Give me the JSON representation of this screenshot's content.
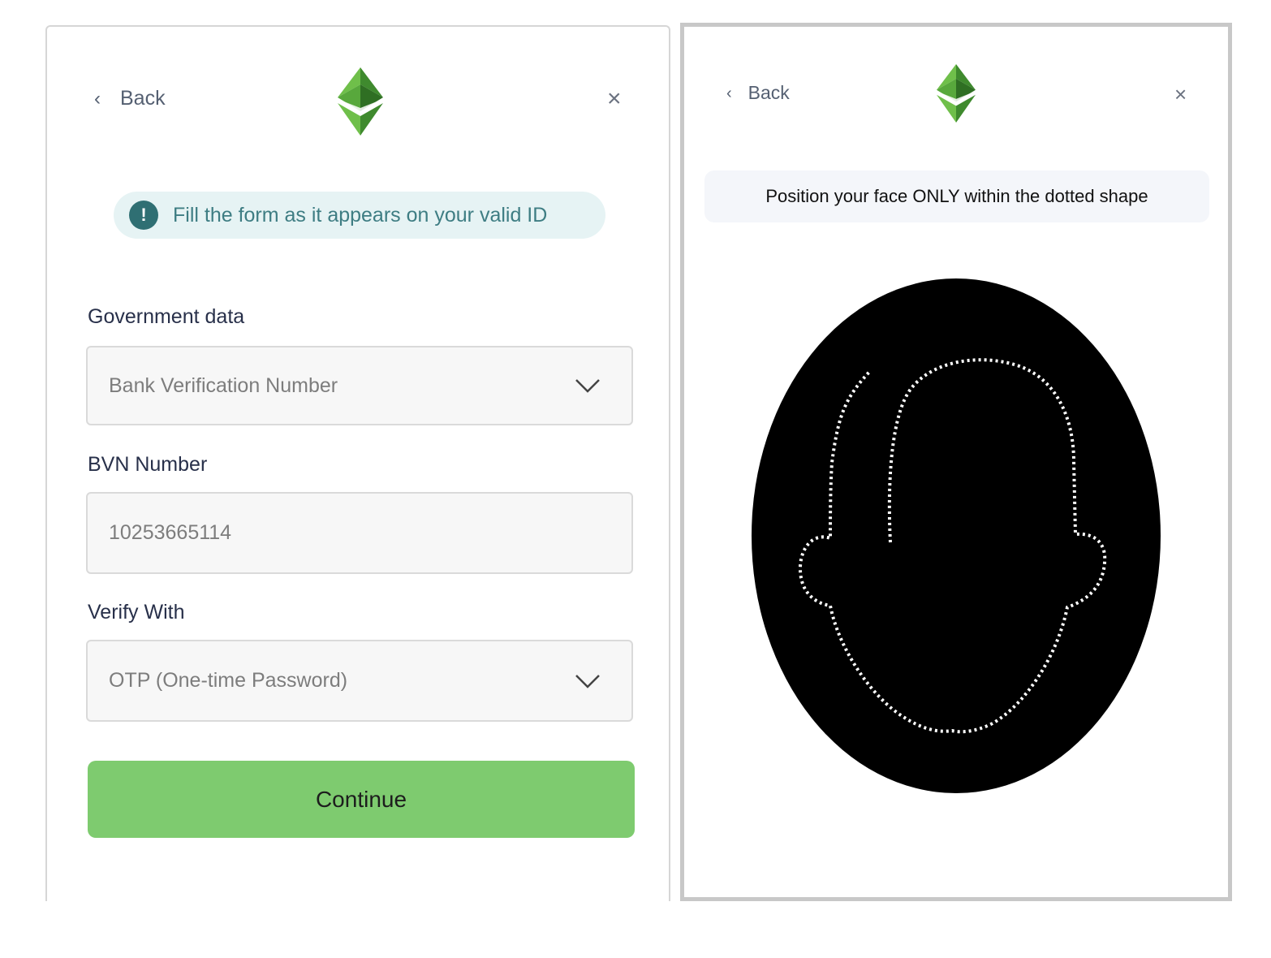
{
  "form_panel": {
    "back_label": "Back",
    "logo_icon": "ethereum-classic-logo",
    "close_symbol": "×",
    "notice": {
      "icon_symbol": "!",
      "text": "Fill the form as it appears on your valid ID"
    },
    "government_data": {
      "label": "Government data",
      "value": "Bank Verification Number"
    },
    "bvn": {
      "label": "BVN Number",
      "value": "10253665114"
    },
    "verify_with": {
      "label": "Verify With",
      "value": "OTP (One-time Password)"
    },
    "continue_label": "Continue"
  },
  "face_panel": {
    "back_label": "Back",
    "logo_icon": "ethereum-classic-logo",
    "close_symbol": "×",
    "instruction": "Position your face ONLY within the dotted shape"
  },
  "colors": {
    "accent_green": "#7ecb6f",
    "notice_bg": "#e6f3f4",
    "notice_text": "#3e7d83",
    "label_text": "#28304a",
    "camera_bg": "#000000",
    "face_outline": "#ffffff"
  }
}
